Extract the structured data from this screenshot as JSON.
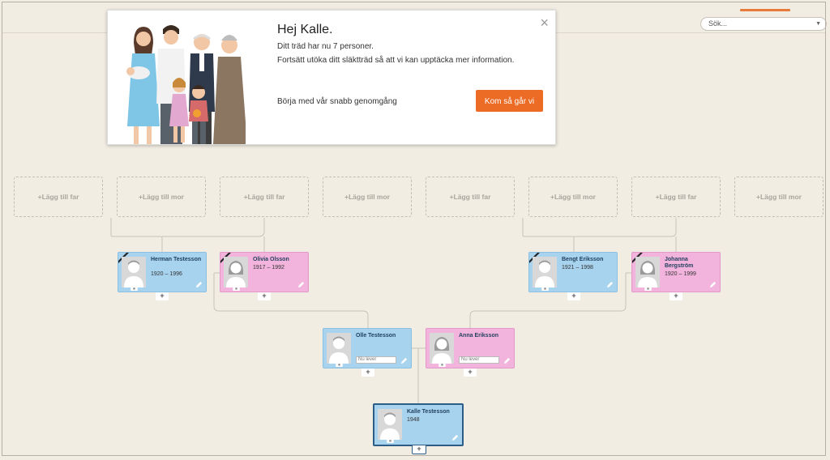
{
  "search": {
    "placeholder": "Sök..."
  },
  "popup": {
    "greeting": "Hej Kalle.",
    "line1": "Ditt träd har nu 7 personer.",
    "line2": "Fortsätt utöka ditt släktträd så att vi kan upptäcka mer information.",
    "start_text": "Börja med vår snabb genomgång",
    "cta_label": "Kom så går vi",
    "close_glyph": "×"
  },
  "tree": {
    "add_father": "+Lägg till far",
    "add_mother": "+Lägg till mor",
    "alive_placeholder": "Nu lever",
    "plus_glyph": "+",
    "people": {
      "herman": {
        "name": "Herman Testesson",
        "years": "1920 – 1996"
      },
      "olivia": {
        "name": "Olivia Olsson",
        "years": "1917 – 1992"
      },
      "bengt": {
        "name": "Bengt Eriksson",
        "years": "1921 – 1998"
      },
      "johanna": {
        "name": "Johanna Bergström",
        "years": "1920 – 1999"
      },
      "olle": {
        "name": "Olle Testesson",
        "years": ""
      },
      "anna": {
        "name": "Anna Eriksson",
        "years": ""
      },
      "kalle": {
        "name": "Kalle Testesson",
        "years": "1948"
      }
    }
  },
  "colors": {
    "male": "#a7d3ee",
    "female": "#f2b4dd",
    "accent": "#ec6b25",
    "background": "#f1ede3"
  }
}
